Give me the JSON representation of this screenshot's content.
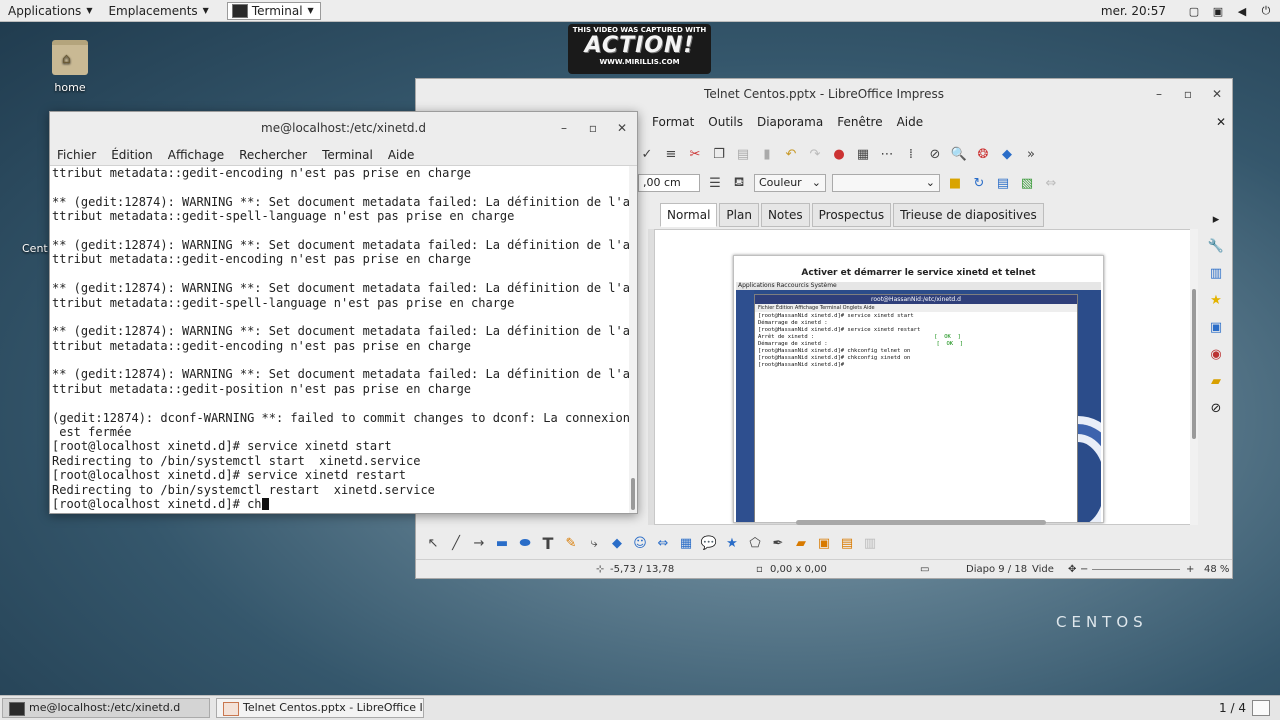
{
  "topbar": {
    "applications": "Applications",
    "places": "Emplacements",
    "terminal": "Terminal",
    "clock": "mer. 20:57"
  },
  "desktop": {
    "home_label": "home",
    "cent_label": "Cent",
    "brand": "CENTOS"
  },
  "watermark": {
    "top": "THIS VIDEO WAS CAPTURED WITH",
    "main": "ACTION!",
    "bottom": "WWW.MIRILLIS.COM"
  },
  "impress": {
    "title": "Telnet Centos.pptx - LibreOffice Impress",
    "menu": [
      "Format",
      "Outils",
      "Diaporama",
      "Fenêtre",
      "Aide"
    ],
    "width_field": ",00 cm",
    "color_select": "Couleur",
    "tabs": [
      "Normal",
      "Plan",
      "Notes",
      "Prospectus",
      "Trieuse de diapositives"
    ],
    "slide_title": "Activer et démarrer  le service xinetd et telnet",
    "inner_bar": "Applications   Raccourcis   Système",
    "inner_title": "root@HassanNid:/etc/xinetd.d",
    "inner_menu": "Fichier   Édition   Affichage   Terminal   Onglets   Aide",
    "inner_lines": [
      "[root@HassanNid xinetd.d]# service xinetd start",
      "Démarrage de xinetd :",
      "[root@HassanNid xinetd.d]# service xinetd restart",
      "Arrêt de xinetd :",
      "Démarrage de xinetd :",
      "[root@HassanNid xinetd.d]# chkconfig telnet on",
      "[root@HassanNid xinetd.d]# chkconfig xinetd on",
      "[root@HassanNid xinetd.d]#"
    ],
    "inner_ok": "[  OK  ]",
    "status": {
      "position": "-5,73 / 13,78",
      "size": "0,00 x 0,00",
      "slide": "Diapo 9 / 18",
      "layout": "Vide",
      "zoom": "48 %"
    }
  },
  "terminal": {
    "title": "me@localhost:/etc/xinetd.d",
    "menu": [
      "Fichier",
      "Édition",
      "Affichage",
      "Rechercher",
      "Terminal",
      "Aide"
    ],
    "lines": [
      "ttribut metadata::gedit-encoding n'est pas prise en charge",
      "",
      "** (gedit:12874): WARNING **: Set document metadata failed: La définition de l'a",
      "ttribut metadata::gedit-spell-language n'est pas prise en charge",
      "",
      "** (gedit:12874): WARNING **: Set document metadata failed: La définition de l'a",
      "ttribut metadata::gedit-encoding n'est pas prise en charge",
      "",
      "** (gedit:12874): WARNING **: Set document metadata failed: La définition de l'a",
      "ttribut metadata::gedit-spell-language n'est pas prise en charge",
      "",
      "** (gedit:12874): WARNING **: Set document metadata failed: La définition de l'a",
      "ttribut metadata::gedit-encoding n'est pas prise en charge",
      "",
      "** (gedit:12874): WARNING **: Set document metadata failed: La définition de l'a",
      "ttribut metadata::gedit-position n'est pas prise en charge",
      "",
      "(gedit:12874): dconf-WARNING **: failed to commit changes to dconf: La connexion",
      " est fermée",
      "[root@localhost xinetd.d]# service xinetd start",
      "Redirecting to /bin/systemctl start  xinetd.service",
      "[root@localhost xinetd.d]# service xinetd restart",
      "Redirecting to /bin/systemctl restart  xinetd.service"
    ],
    "prompt": "[root@localhost xinetd.d]# ",
    "typed": "ch"
  },
  "taskbar": {
    "task1": "me@localhost:/etc/xinetd.d",
    "task2": "Telnet Centos.pptx - LibreOffice I...",
    "workspace": "1 / 4"
  }
}
